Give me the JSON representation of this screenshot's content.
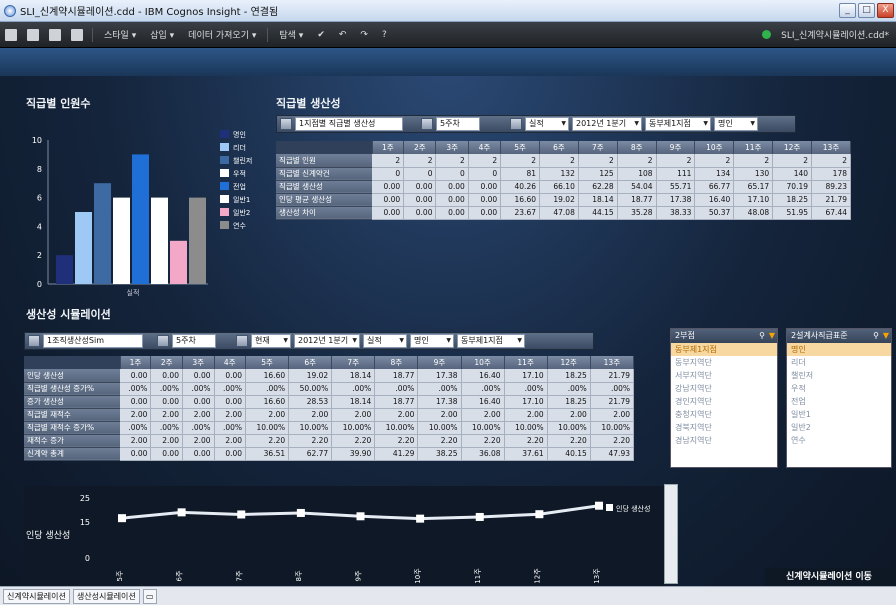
{
  "window": {
    "title": "SLI_신계약시뮬레이션.cdd - IBM Cognos Insight - 연결됨",
    "min": "_",
    "max": "□",
    "close": "X"
  },
  "toolbar": {
    "items": [
      "스타일 ▾",
      "삽입 ▾",
      "데이터 가져오기 ▾",
      "탐색 ▾"
    ],
    "doc_name": "SLI_신계약시뮬레이션.cdd*"
  },
  "section1": {
    "title": "직급별 인원수"
  },
  "bar_chart": {
    "title": "",
    "xlabel": "실적",
    "type": "bar",
    "ylim": [
      0,
      10
    ],
    "yticks": [
      "10",
      "8",
      "6",
      "4",
      "2",
      "0"
    ],
    "legend": [
      {
        "name": "명인",
        "color": "#1f2f7a"
      },
      {
        "name": "리더",
        "color": "#9fc9f5"
      },
      {
        "name": "챌린저",
        "color": "#3d6aa3"
      },
      {
        "name": "우적",
        "color": "#ffffff"
      },
      {
        "name": "전업",
        "color": "#1f6fd6"
      },
      {
        "name": "일반1",
        "color": "#ffffff"
      },
      {
        "name": "일반2",
        "color": "#f3a8c8"
      },
      {
        "name": "연수",
        "color": "#8c8c8c"
      }
    ]
  },
  "chart_data": {
    "type": "bar",
    "categories": [
      "실적"
    ],
    "series": [
      {
        "name": "명인",
        "values": [
          2
        ]
      },
      {
        "name": "리더",
        "values": [
          5
        ]
      },
      {
        "name": "챌린저",
        "values": [
          7
        ]
      },
      {
        "name": "우적",
        "values": [
          6
        ]
      },
      {
        "name": "전업",
        "values": [
          9
        ]
      },
      {
        "name": "일반1",
        "values": [
          6
        ]
      },
      {
        "name": "일반2",
        "values": [
          3
        ]
      },
      {
        "name": "연수",
        "values": [
          6
        ]
      }
    ],
    "xlabel": "실적",
    "ylabel": "",
    "ylim": [
      0,
      10
    ]
  },
  "section2": {
    "title": "직급별 생산성",
    "controls": [
      "1지점별 직급별 생산성",
      "5주차",
      "실적",
      "2012년 1분기",
      "동부제1지점",
      "명인"
    ],
    "columns": [
      "1주",
      "2주",
      "3주",
      "4주",
      "5주",
      "6주",
      "7주",
      "8주",
      "9주",
      "10주",
      "11주",
      "12주",
      "13주"
    ],
    "rows": [
      {
        "label": "직급별 인원",
        "values": [
          "2",
          "2",
          "2",
          "2",
          "2",
          "2",
          "2",
          "2",
          "2",
          "2",
          "2",
          "2",
          "2"
        ]
      },
      {
        "label": "직급별 신계약건",
        "values": [
          "0",
          "0",
          "0",
          "0",
          "81",
          "132",
          "125",
          "108",
          "111",
          "134",
          "130",
          "140",
          "178"
        ]
      },
      {
        "label": "직급별 생산성",
        "values": [
          "0.00",
          "0.00",
          "0.00",
          "0.00",
          "40.26",
          "66.10",
          "62.28",
          "54.04",
          "55.71",
          "66.77",
          "65.17",
          "70.19",
          "89.23"
        ]
      },
      {
        "label": "인당 평균 생산성",
        "values": [
          "0.00",
          "0.00",
          "0.00",
          "0.00",
          "16.60",
          "19.02",
          "18.14",
          "18.77",
          "17.38",
          "16.40",
          "17.10",
          "18.25",
          "21.79"
        ]
      },
      {
        "label": "생산성 차이",
        "values": [
          "0.00",
          "0.00",
          "0.00",
          "0.00",
          "23.67",
          "47.08",
          "44.15",
          "35.28",
          "38.33",
          "50.37",
          "48.08",
          "51.95",
          "67.44"
        ]
      }
    ]
  },
  "section3": {
    "title": "생산성 시뮬레이션",
    "controls": [
      "1조직생산성Sim",
      "5주차",
      "현재",
      "2012년 1분기",
      "실적",
      "명인",
      "동부제1지점"
    ],
    "columns": [
      "1주",
      "2주",
      "3주",
      "4주",
      "5주",
      "6주",
      "7주",
      "8주",
      "9주",
      "10주",
      "11주",
      "12주",
      "13주"
    ],
    "rows": [
      {
        "label": "인당 생산성",
        "values": [
          "0.00",
          "0.00",
          "0.00",
          "0.00",
          "16.60",
          "19.02",
          "18.14",
          "18.77",
          "17.38",
          "16.40",
          "17.10",
          "18.25",
          "21.79"
        ]
      },
      {
        "label": "직급별 생산성 증가%",
        "values": [
          ".00%",
          ".00%",
          ".00%",
          ".00%",
          ".00%",
          "50.00%",
          ".00%",
          ".00%",
          ".00%",
          ".00%",
          ".00%",
          ".00%",
          ".00%"
        ]
      },
      {
        "label": "증가 생산성",
        "values": [
          "0.00",
          "0.00",
          "0.00",
          "0.00",
          "16.60",
          "28.53",
          "18.14",
          "18.77",
          "17.38",
          "16.40",
          "17.10",
          "18.25",
          "21.79"
        ]
      },
      {
        "label": "직급별 재적수",
        "values": [
          "2.00",
          "2.00",
          "2.00",
          "2.00",
          "2.00",
          "2.00",
          "2.00",
          "2.00",
          "2.00",
          "2.00",
          "2.00",
          "2.00",
          "2.00"
        ]
      },
      {
        "label": "직급별 재적수 증가%",
        "values": [
          ".00%",
          ".00%",
          ".00%",
          ".00%",
          "10.00%",
          "10.00%",
          "10.00%",
          "10.00%",
          "10.00%",
          "10.00%",
          "10.00%",
          "10.00%",
          "10.00%"
        ]
      },
      {
        "label": "재적수 증가",
        "values": [
          "2.00",
          "2.00",
          "2.00",
          "2.00",
          "2.20",
          "2.20",
          "2.20",
          "2.20",
          "2.20",
          "2.20",
          "2.20",
          "2.20",
          "2.20"
        ]
      },
      {
        "label": "신계약 총계",
        "values": [
          "0.00",
          "0.00",
          "0.00",
          "0.00",
          "36.51",
          "62.77",
          "39.90",
          "41.29",
          "38.25",
          "36.08",
          "37.61",
          "40.15",
          "47.93"
        ]
      }
    ]
  },
  "list1": {
    "header": "2부점",
    "items": [
      "동부제1지점",
      "동부지역단",
      "서부지역단",
      "강남지역단",
      "경인지역단",
      "충청지역단",
      "경북지역단",
      "경남지역단"
    ],
    "selected": 0
  },
  "list2": {
    "header": "2설계사직급표준",
    "items": [
      "명인",
      "리더",
      "챌린저",
      "우적",
      "전업",
      "일반1",
      "일반2",
      "연수"
    ],
    "selected": 0
  },
  "line_chart": {
    "ylabel": "인당 생산성",
    "legend": "인당 생산성",
    "yticks": [
      "25",
      "15",
      "0"
    ],
    "categories": [
      "5주",
      "6주",
      "7주",
      "8주",
      "9주",
      "10주",
      "11주",
      "12주",
      "13주"
    ]
  },
  "line_chart_data": {
    "type": "line",
    "x": [
      "5주",
      "6주",
      "7주",
      "8주",
      "9주",
      "10주",
      "11주",
      "12주",
      "13주"
    ],
    "values": [
      16.6,
      19.02,
      18.14,
      18.77,
      17.38,
      16.4,
      17.1,
      18.25,
      21.79
    ],
    "ylim": [
      0,
      25
    ]
  },
  "nav_button": "신계약시뮬레이션 이동",
  "status_tabs": [
    "신계약시뮬레이션",
    "생산성시뮬레이션"
  ]
}
